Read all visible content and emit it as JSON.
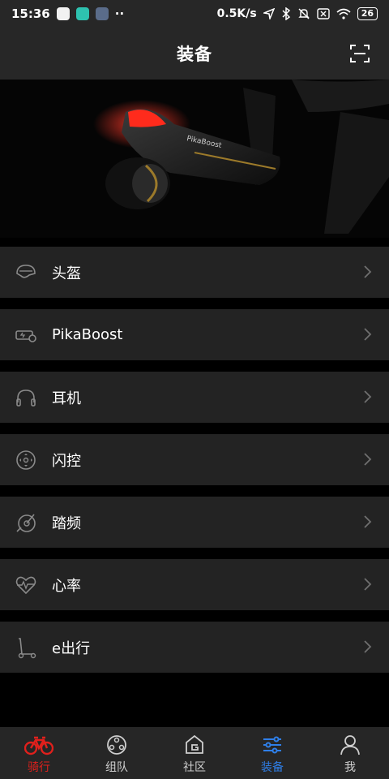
{
  "status_bar": {
    "time": "15:36",
    "network_speed": "0.5K/s",
    "battery": "26",
    "more_indicator": "··"
  },
  "header": {
    "title": "装备"
  },
  "banner": {
    "device_text": "PikaBoost"
  },
  "equipment_list": [
    {
      "label": "头盔",
      "icon": "helmet-icon"
    },
    {
      "label": "PikaBoost",
      "icon": "battery-motor-icon"
    },
    {
      "label": "耳机",
      "icon": "headphones-icon"
    },
    {
      "label": "闪控",
      "icon": "remote-control-icon"
    },
    {
      "label": "踏频",
      "icon": "cadence-sensor-icon"
    },
    {
      "label": "心率",
      "icon": "heart-rate-icon"
    },
    {
      "label": "e出行",
      "icon": "scooter-icon"
    }
  ],
  "tabs": [
    {
      "label": "骑行",
      "icon": "bike-icon",
      "active": true,
      "color": "#e0201c"
    },
    {
      "label": "组队",
      "icon": "team-icon",
      "active": false
    },
    {
      "label": "社区",
      "icon": "community-icon",
      "active": false
    },
    {
      "label": "装备",
      "icon": "equipment-icon",
      "active": true,
      "color": "#2f7fe8"
    },
    {
      "label": "我",
      "icon": "profile-icon",
      "active": false
    }
  ],
  "colors": {
    "background": "#000000",
    "row_background": "#232323",
    "bar_background": "#272727",
    "accent_red": "#e0201c",
    "accent_blue": "#2f7fe8"
  }
}
